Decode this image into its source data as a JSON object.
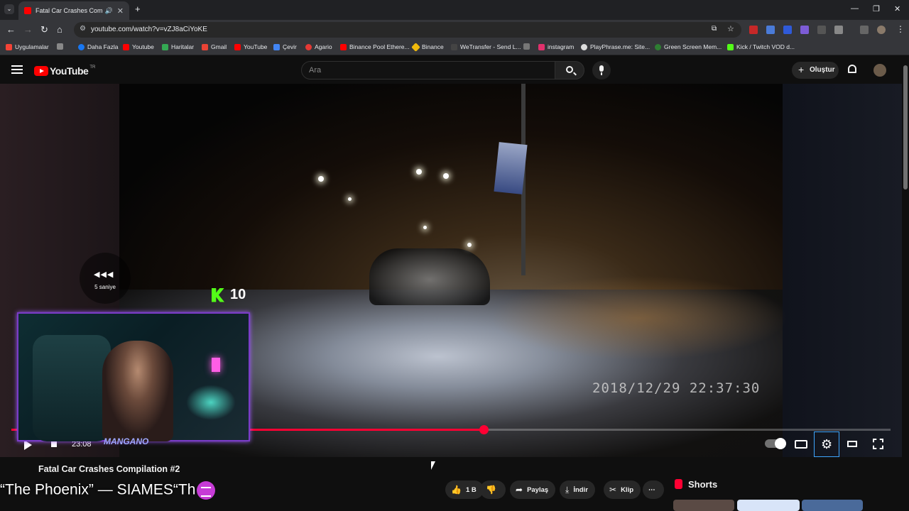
{
  "browser": {
    "tab_title": "Fatal Car Crashes Compilation",
    "url": "youtube.com/watch?v=vZJ8aCiYoKE",
    "bookmarks": [
      "Uygulamalar",
      "Daha Fazla",
      "Youtube",
      "Haritalar",
      "Gmail",
      "YouTube",
      "Çevir",
      "Agario",
      "Binance Pool Ethere...",
      "Binance",
      "WeTransfer - Send L...",
      "instagram",
      "PlayPhrase.me: Site...",
      "Green Screen Mem...",
      "Kick / Twitch VOD d..."
    ]
  },
  "youtube": {
    "logo": "YouTube",
    "country": "TR",
    "search_placeholder": "Ara",
    "create_label": "Oluştur"
  },
  "player": {
    "rewind_label": "5 saniye",
    "kick_count": "10",
    "video_timestamp": "2018/12/29  22:37:30",
    "webcam_name": "MANGANO",
    "time": "23:08",
    "progress": 0.537
  },
  "below": {
    "title": "Fatal Car Crashes Compilation #2",
    "like_count": "1 B",
    "share_label": "Paylaş",
    "download_label": "İndir",
    "clip_label": "Klip",
    "more_label": "⋯",
    "shorts_label": "Shorts"
  },
  "overlay": {
    "now_playing": "“The Phoenix” — SIAMES“Th"
  },
  "colors": {
    "accent": "#ff0033",
    "kick": "#53fc18"
  }
}
